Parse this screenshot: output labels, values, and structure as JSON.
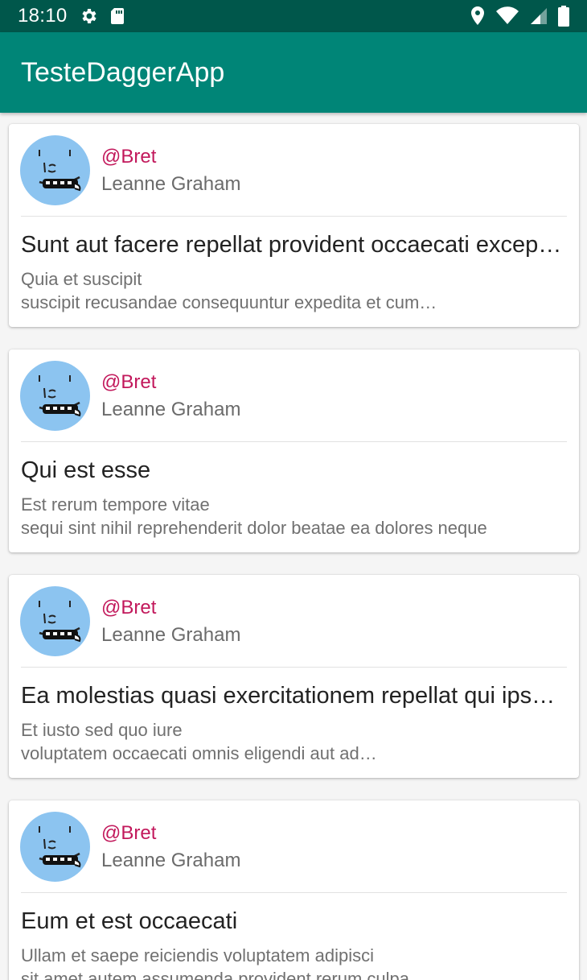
{
  "status_bar": {
    "time": "18:10",
    "icons": [
      "gear-icon",
      "sd-card-icon",
      "location-icon",
      "wifi-icon",
      "signal-icon",
      "battery-icon"
    ]
  },
  "app_bar": {
    "title": "TesteDaggerApp"
  },
  "colors": {
    "status_bar": "#00574b",
    "app_bar": "#008577",
    "username": "#c2185b",
    "avatar_bg": "#8cc4f0"
  },
  "posts": [
    {
      "username": "@Bret",
      "name": "Leanne Graham",
      "title": "Sunt aut facere repellat provident occaecati excepturi optio reprehenderit",
      "body_line1": "Quia et suscipit",
      "body_line2": "suscipit recusandae consequuntur expedita et cum…"
    },
    {
      "username": "@Bret",
      "name": "Leanne Graham",
      "title": "Qui est esse",
      "body_line1": "Est rerum tempore vitae",
      "body_line2": "sequi sint nihil reprehenderit dolor beatae ea dolores neque"
    },
    {
      "username": "@Bret",
      "name": "Leanne Graham",
      "title": "Ea molestias quasi exercitationem repellat qui ipsa sit aut",
      "body_line1": "Et iusto sed quo iure",
      "body_line2": "voluptatem occaecati omnis eligendi aut ad…"
    },
    {
      "username": "@Bret",
      "name": "Leanne Graham",
      "title": "Eum et est occaecati",
      "body_line1": "Ullam et saepe reiciendis voluptatem adipisci",
      "body_line2": "sit amet autem assumenda provident rerum culpa"
    }
  ]
}
